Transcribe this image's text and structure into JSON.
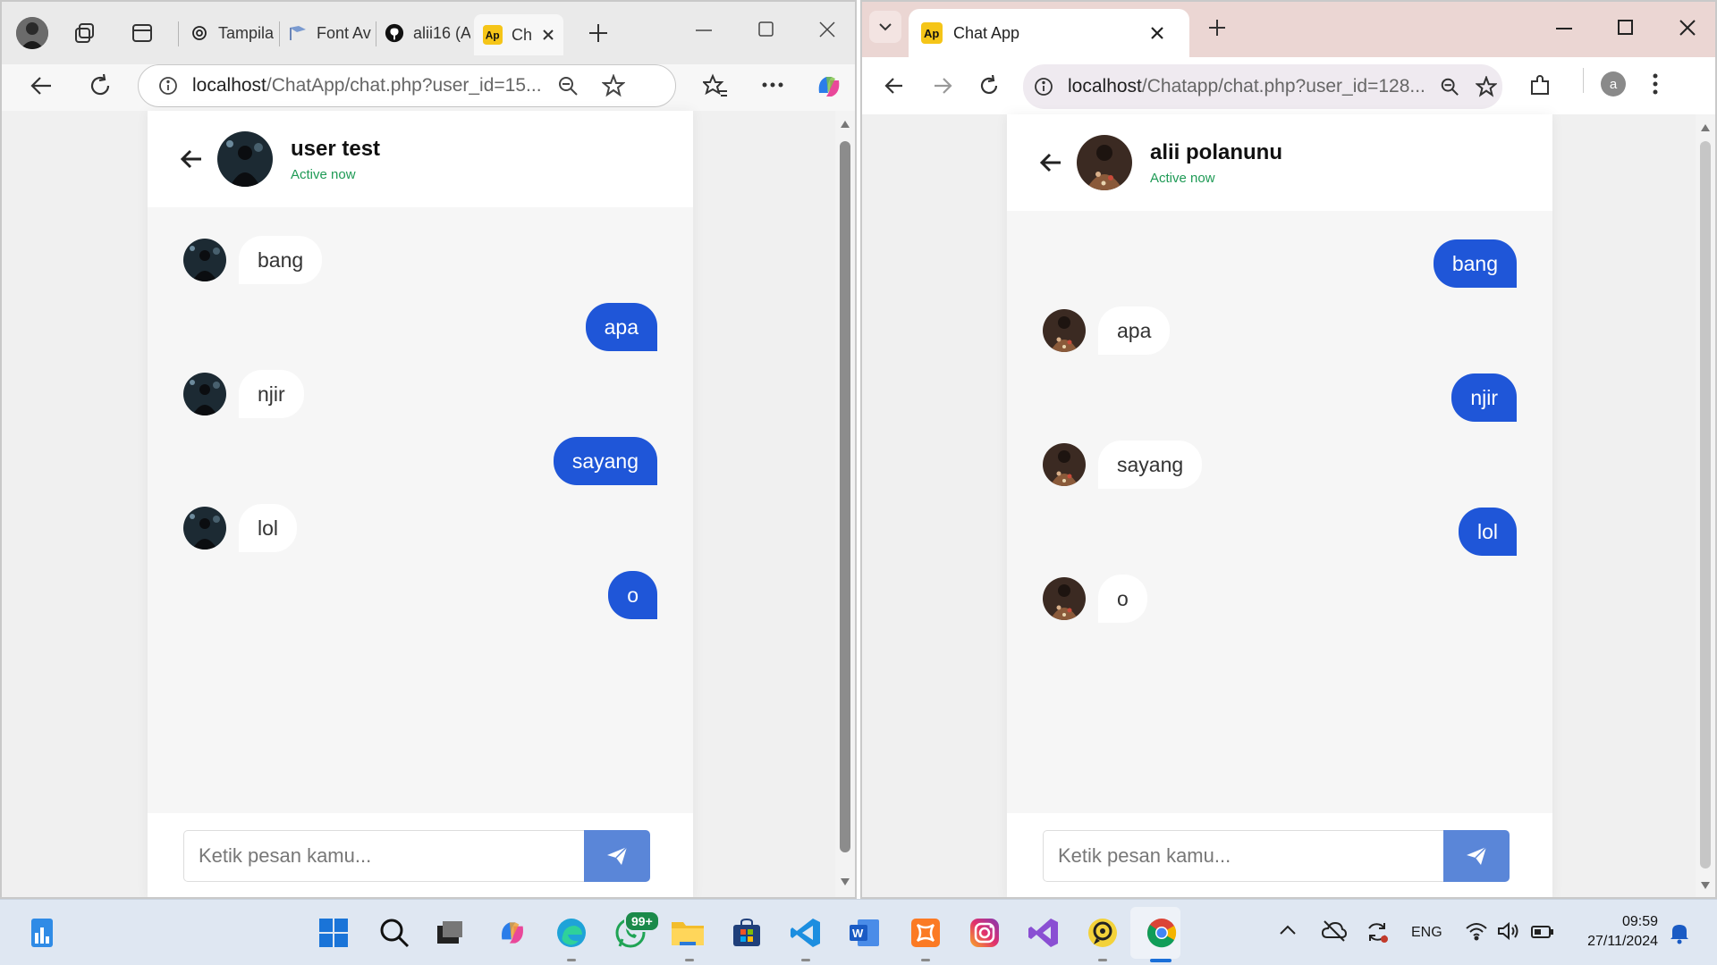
{
  "left_window": {
    "tabs": [
      {
        "label": "Tampila"
      },
      {
        "label": "Font Av"
      },
      {
        "label": "alii16 (A"
      },
      {
        "label": "Ch"
      }
    ],
    "url_host": "localhost",
    "url_path": "/ChatApp/chat.php?user_id=15...",
    "chat": {
      "user_name": "user test",
      "status": "Active now",
      "messages": [
        {
          "dir": "in",
          "text": "bang"
        },
        {
          "dir": "out",
          "text": "apa"
        },
        {
          "dir": "in",
          "text": "njir"
        },
        {
          "dir": "out",
          "text": "sayang"
        },
        {
          "dir": "in",
          "text": "lol"
        },
        {
          "dir": "out",
          "text": "o"
        }
      ],
      "input_placeholder": "Ketik pesan kamu..."
    }
  },
  "right_window": {
    "tab_title": "Chat App",
    "url_host": "localhost",
    "url_path": "/Chatapp/chat.php?user_id=128...",
    "profile_initial": "a",
    "chat": {
      "user_name": "alii polanunu",
      "status": "Active now",
      "messages": [
        {
          "dir": "out",
          "text": "bang"
        },
        {
          "dir": "in",
          "text": "apa"
        },
        {
          "dir": "out",
          "text": "njir"
        },
        {
          "dir": "in",
          "text": "sayang"
        },
        {
          "dir": "out",
          "text": "lol"
        },
        {
          "dir": "in",
          "text": "o"
        }
      ],
      "input_placeholder": "Ketik pesan kamu..."
    }
  },
  "taskbar": {
    "whatsapp_badge": "99+",
    "language": "ENG",
    "time": "09:59",
    "date": "27/11/2024"
  },
  "colors": {
    "outgoing_bubble": "#1f56d8",
    "incoming_bubble": "#ffffff",
    "send_button": "#5a86d8",
    "status_active": "#1e9a55"
  }
}
